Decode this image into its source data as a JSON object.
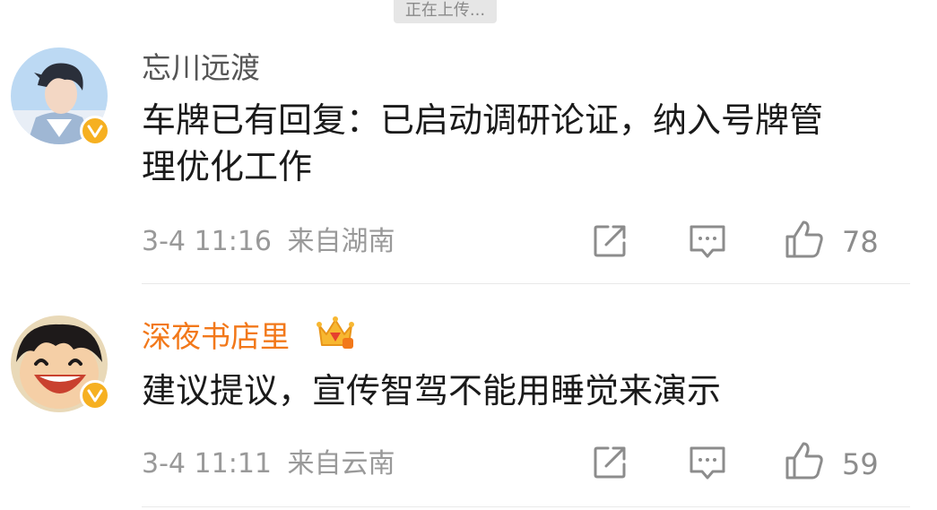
{
  "toast": {
    "text": "正在上传..."
  },
  "comments": [
    {
      "username": "忘川远渡",
      "content": "车牌已有回复：已启动调研论证，纳入号牌管理优化工作",
      "time": "3-4 11:16",
      "location": "来自湖南",
      "likes": "78",
      "verified_badge": "v-badge-icon"
    },
    {
      "username": "深夜书店里",
      "content": "建议提议，宣传智驾不能用睡觉来演示",
      "time": "3-4 11:11",
      "location": "来自云南",
      "likes": "59",
      "verified_badge": "v-badge-icon",
      "vip_badge": "crown-icon"
    }
  ],
  "colors": {
    "username": "#555555",
    "vip_username": "#f2781a",
    "badge": "#f6b021",
    "meta": "#999999"
  }
}
